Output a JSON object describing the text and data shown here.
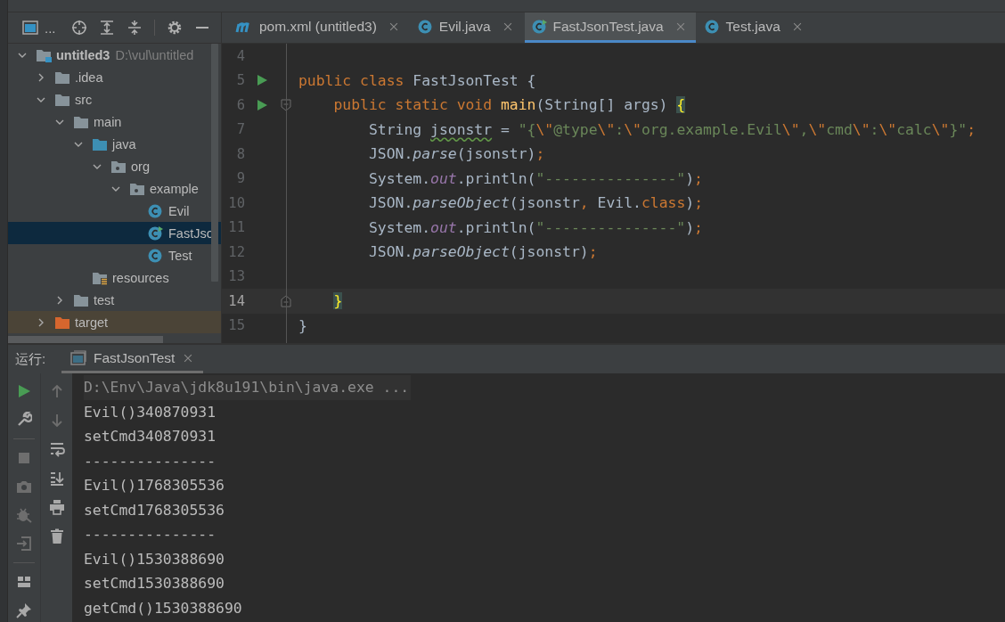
{
  "project_panel": {
    "header_label": "...",
    "tree": [
      {
        "label": "untitled3",
        "detail": "D:\\vul\\untitled",
        "kind": "module",
        "expanded": true,
        "selected": false,
        "children": [
          {
            "label": ".idea",
            "kind": "folder",
            "expanded": false,
            "selected": false
          },
          {
            "label": "src",
            "kind": "folder",
            "expanded": true,
            "selected": false,
            "children": [
              {
                "label": "main",
                "kind": "folder",
                "expanded": true,
                "selected": false,
                "children": [
                  {
                    "label": "java",
                    "kind": "source-folder",
                    "expanded": true,
                    "selected": false,
                    "children": [
                      {
                        "label": "org",
                        "kind": "package",
                        "expanded": true,
                        "selected": false,
                        "children": [
                          {
                            "label": "example",
                            "kind": "package",
                            "expanded": true,
                            "selected": false,
                            "children": [
                              {
                                "label": "Evil",
                                "kind": "class",
                                "selected": false
                              },
                              {
                                "label": "FastJso",
                                "kind": "runnable-class",
                                "selected": true
                              },
                              {
                                "label": "Test",
                                "kind": "class",
                                "selected": false
                              }
                            ]
                          }
                        ]
                      }
                    ]
                  },
                  {
                    "label": "resources",
                    "kind": "resources-folder",
                    "selected": false
                  }
                ]
              },
              {
                "label": "test",
                "kind": "folder",
                "expanded": false,
                "selected": false
              }
            ]
          },
          {
            "label": "target",
            "kind": "excluded-folder",
            "expanded": false,
            "selected": false
          }
        ]
      }
    ]
  },
  "editor_tabs": [
    {
      "label": "pom.xml (untitled3)",
      "kind": "maven",
      "selected": false
    },
    {
      "label": "Evil.java",
      "kind": "class",
      "selected": false
    },
    {
      "label": "FastJsonTest.java",
      "kind": "runnable-class",
      "selected": true
    },
    {
      "label": "Test.java",
      "kind": "class",
      "selected": false
    }
  ],
  "editor": {
    "lines": [
      {
        "number": "4",
        "current": false,
        "runnable": false,
        "fold_start": false,
        "fold_end": false
      },
      {
        "number": "5",
        "current": false,
        "runnable": true,
        "fold_start": false,
        "fold_end": false,
        "tokens": [
          {
            "kind": "kw",
            "text": "public class "
          },
          {
            "kind": "plain",
            "text": "FastJsonTest {"
          }
        ]
      },
      {
        "number": "6",
        "current": false,
        "runnable": true,
        "fold_start": true,
        "fold_end": false,
        "tokens": [
          {
            "kind": "kw",
            "text": "    public static void "
          },
          {
            "kind": "decl",
            "text": "main"
          },
          {
            "kind": "plain",
            "text": "(String[] args) "
          },
          {
            "kind": "brace",
            "text": "{"
          }
        ]
      },
      {
        "number": "7",
        "current": false,
        "runnable": false,
        "fold_start": false,
        "fold_end": false,
        "tokens": [
          {
            "kind": "plain",
            "text": "        String "
          },
          {
            "kind": "warn",
            "text": "jsonstr"
          },
          {
            "kind": "plain",
            "text": " = "
          },
          {
            "kind": "str",
            "text": "\"{"
          },
          {
            "kind": "esc",
            "text": "\\\""
          },
          {
            "kind": "str",
            "text": "@type"
          },
          {
            "kind": "esc",
            "text": "\\\""
          },
          {
            "kind": "str",
            "text": ":"
          },
          {
            "kind": "esc",
            "text": "\\\""
          },
          {
            "kind": "str",
            "text": "org.example.Evil"
          },
          {
            "kind": "esc",
            "text": "\\\""
          },
          {
            "kind": "str",
            "text": ","
          },
          {
            "kind": "esc",
            "text": "\\\""
          },
          {
            "kind": "str",
            "text": "cmd"
          },
          {
            "kind": "esc",
            "text": "\\\""
          },
          {
            "kind": "str",
            "text": ":"
          },
          {
            "kind": "esc",
            "text": "\\\""
          },
          {
            "kind": "str",
            "text": "calc"
          },
          {
            "kind": "esc",
            "text": "\\\""
          },
          {
            "kind": "str",
            "text": "}\""
          },
          {
            "kind": "semi",
            "text": ";"
          }
        ]
      },
      {
        "number": "8",
        "current": false,
        "runnable": false,
        "fold_start": false,
        "fold_end": false,
        "tokens": [
          {
            "kind": "plain",
            "text": "        JSON."
          },
          {
            "kind": "call",
            "text": "parse"
          },
          {
            "kind": "plain",
            "text": "(jsonstr)"
          },
          {
            "kind": "semi",
            "text": ";"
          }
        ]
      },
      {
        "number": "9",
        "current": false,
        "runnable": false,
        "fold_start": false,
        "fold_end": false,
        "tokens": [
          {
            "kind": "plain",
            "text": "        System."
          },
          {
            "kind": "field",
            "text": "out"
          },
          {
            "kind": "plain",
            "text": ".println("
          },
          {
            "kind": "str",
            "text": "\"---------------\""
          },
          {
            "kind": "plain",
            "text": ")"
          },
          {
            "kind": "semi",
            "text": ";"
          }
        ]
      },
      {
        "number": "10",
        "current": false,
        "runnable": false,
        "fold_start": false,
        "fold_end": false,
        "tokens": [
          {
            "kind": "plain",
            "text": "        JSON."
          },
          {
            "kind": "call",
            "text": "parseObject"
          },
          {
            "kind": "plain",
            "text": "(jsonstr"
          },
          {
            "kind": "semi",
            "text": ", "
          },
          {
            "kind": "plain",
            "text": "Evil."
          },
          {
            "kind": "kw",
            "text": "class"
          },
          {
            "kind": "plain",
            "text": ")"
          },
          {
            "kind": "semi",
            "text": ";"
          }
        ]
      },
      {
        "number": "11",
        "current": false,
        "runnable": false,
        "fold_start": false,
        "fold_end": false,
        "tokens": [
          {
            "kind": "plain",
            "text": "        System."
          },
          {
            "kind": "field",
            "text": "out"
          },
          {
            "kind": "plain",
            "text": ".println("
          },
          {
            "kind": "str",
            "text": "\"---------------\""
          },
          {
            "kind": "plain",
            "text": ")"
          },
          {
            "kind": "semi",
            "text": ";"
          }
        ]
      },
      {
        "number": "12",
        "current": false,
        "runnable": false,
        "fold_start": false,
        "fold_end": false,
        "tokens": [
          {
            "kind": "plain",
            "text": "        JSON."
          },
          {
            "kind": "call",
            "text": "parseObject"
          },
          {
            "kind": "plain",
            "text": "(jsonstr)"
          },
          {
            "kind": "semi",
            "text": ";"
          }
        ]
      },
      {
        "number": "13",
        "current": false,
        "runnable": false,
        "fold_start": false,
        "fold_end": false
      },
      {
        "number": "14",
        "current": true,
        "runnable": false,
        "fold_start": false,
        "fold_end": true,
        "tokens": [
          {
            "kind": "brace",
            "text": "    }"
          }
        ]
      },
      {
        "number": "15",
        "current": false,
        "runnable": false,
        "fold_start": false,
        "fold_end": false,
        "tokens": [
          {
            "kind": "plain",
            "text": "}"
          }
        ]
      }
    ]
  },
  "run_panel": {
    "label": "运行:",
    "tab": {
      "label": "FastJsonTest",
      "selected": true
    },
    "console": [
      {
        "kind": "command",
        "text": "D:\\Env\\Java\\jdk8u191\\bin\\java.exe ..."
      },
      {
        "kind": "output",
        "text": "Evil()340870931"
      },
      {
        "kind": "output",
        "text": "setCmd340870931"
      },
      {
        "kind": "output",
        "text": "---------------"
      },
      {
        "kind": "output",
        "text": "Evil()1768305536"
      },
      {
        "kind": "output",
        "text": "setCmd1768305536"
      },
      {
        "kind": "output",
        "text": "---------------"
      },
      {
        "kind": "output",
        "text": "Evil()1530388690"
      },
      {
        "kind": "output",
        "text": "setCmd1530388690"
      },
      {
        "kind": "output",
        "text": "getCmd()1530388690"
      }
    ]
  }
}
